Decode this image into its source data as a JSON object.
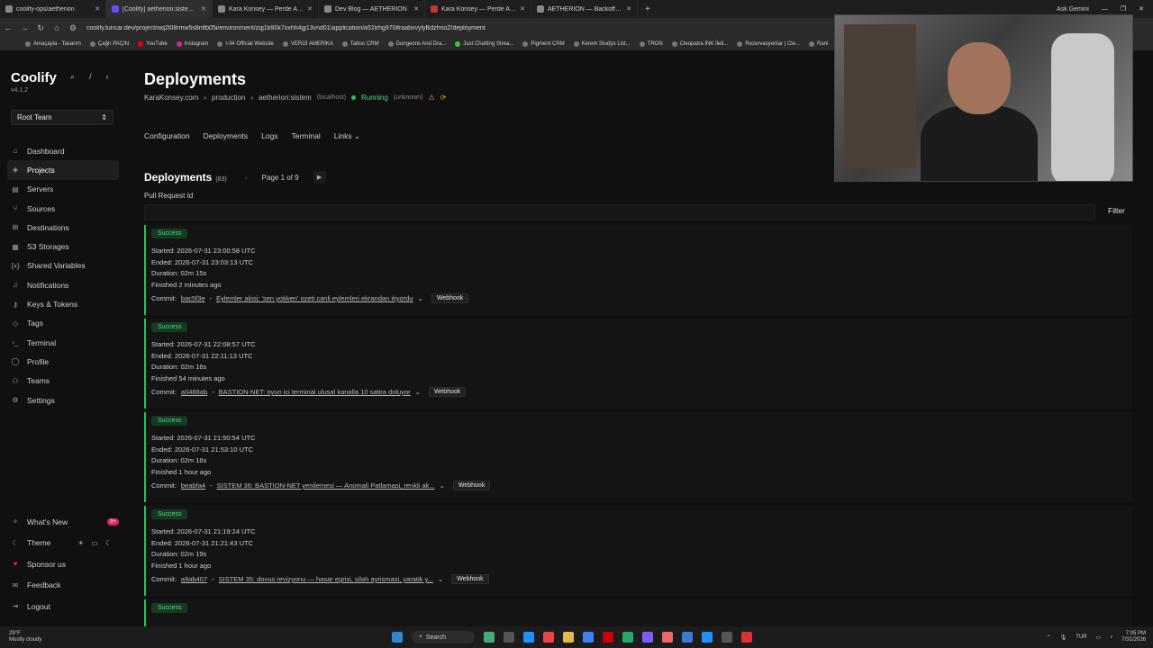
{
  "browser": {
    "tabs": [
      {
        "title": "coolify-ops/aetherion",
        "active": false
      },
      {
        "title": "[Coolify] aetherion:sistem - Deploy",
        "active": true
      },
      {
        "title": "Kara Konsey — Perde Arakası",
        "active": false
      },
      {
        "title": "Dev Blog — AETHERION",
        "active": false
      },
      {
        "title": "Kara Konsey — Perde Arakası",
        "active": false
      },
      {
        "title": "AETHERION — Backoffice",
        "active": false
      }
    ],
    "new_tab": "+",
    "profile": "Ask Gemini",
    "url": "coolify.luncar.dev/project/wq2l08rmw5s8nlfb05i/environment/zqj1b90k7xxhh4gj13vnd01/application/a51trhg970ifraabvvylyBdzhnoZ/deployment",
    "bookmarks": [
      "Amaçayla - Tasarım",
      "Çağrı PAÇIN",
      "YouTube",
      "Instagram",
      "I-94 Official Website",
      "VERGİ AMERİKA",
      "Tattoo CRM",
      "Dungeons And Dra...",
      "Just Chatting Strea...",
      "Pigment CRM",
      "Kerem Studyo List...",
      "TRON",
      "Cleopatra INK İleti...",
      "Rezervasyonlar | Cle...",
      "Rani"
    ]
  },
  "sidebar": {
    "brand": "Coolify",
    "version": "v4.1.2",
    "shortcut": "/",
    "team": "Root Team",
    "items": [
      {
        "label": "Dashboard",
        "icon": "home-icon",
        "active": false
      },
      {
        "label": "Projects",
        "icon": "layers-icon",
        "active": true
      },
      {
        "label": "Servers",
        "icon": "server-icon",
        "active": false
      },
      {
        "label": "Sources",
        "icon": "git-icon",
        "active": false
      },
      {
        "label": "Destinations",
        "icon": "destination-icon",
        "active": false
      },
      {
        "label": "S3 Storages",
        "icon": "storage-icon",
        "active": false
      },
      {
        "label": "Shared Variables",
        "icon": "variable-icon",
        "active": false
      },
      {
        "label": "Notifications",
        "icon": "bell-icon",
        "active": false
      },
      {
        "label": "Keys & Tokens",
        "icon": "key-icon",
        "active": false
      },
      {
        "label": "Tags",
        "icon": "tag-icon",
        "active": false
      },
      {
        "label": "Terminal",
        "icon": "terminal-icon",
        "active": false
      },
      {
        "label": "Profile",
        "icon": "user-icon",
        "active": false
      },
      {
        "label": "Teams",
        "icon": "users-icon",
        "active": false
      },
      {
        "label": "Settings",
        "icon": "gear-icon",
        "active": false
      }
    ],
    "bottom": [
      {
        "label": "What's New",
        "badge": "9+"
      },
      {
        "label": "Theme"
      },
      {
        "label": "Sponsor us"
      },
      {
        "label": "Feedback"
      },
      {
        "label": "Logout"
      }
    ]
  },
  "main": {
    "title": "Deployments",
    "breadcrumb": {
      "project": "KaraKonsey.com",
      "environment": "production",
      "application": "aetherion:sistem",
      "host": "(localhost)",
      "status": "Running",
      "status_detail": "(unknown)"
    },
    "tabs": [
      "Configuration",
      "Deployments",
      "Logs",
      "Terminal",
      "Links"
    ],
    "section_title": "Deployments",
    "count": "(83)",
    "page": "Page 1 of 9",
    "pr_label": "Pull Request Id",
    "filter_label": "Filter",
    "colors": {
      "success": "#22c55e",
      "warning": "#f59e0b"
    }
  },
  "deployments": [
    {
      "status": "Success",
      "started": "Started: 2026-07-31 23:00:58 UTC",
      "ended": "Ended: 2026-07-31 23:03:13 UTC",
      "duration": "Duration: 02m 15s",
      "finished": "Finished 2 minutes ago",
      "commit_label": "Commit:",
      "sha": "bac5f3e",
      "message": "Eylemler akisi: 'sen yokken' ozeti canli eylemleri ekrandan itiyordu",
      "trigger": "Webhook"
    },
    {
      "status": "Success",
      "started": "Started: 2026-07-31 22:08:57 UTC",
      "ended": "Ended: 2026-07-31 22:11:13 UTC",
      "duration": "Duration: 02m 16s",
      "finished": "Finished 54 minutes ago",
      "commit_label": "Commit:",
      "sha": "a0488ab",
      "message": "BASTION-NET: oyun ici terminal ulusal kanalla 10 satira doluyor",
      "trigger": "Webhook"
    },
    {
      "status": "Success",
      "started": "Started: 2026-07-31 21:50:54 UTC",
      "ended": "Ended: 2026-07-31 21:53:10 UTC",
      "duration": "Duration: 02m 16s",
      "finished": "Finished 1 hour ago",
      "commit_label": "Commit:",
      "sha": "beabfa4",
      "message": "SISTEM 36: BASTION-NET yenilemesi — Anomali Patlamasi, renkli ak...",
      "trigger": "Webhook"
    },
    {
      "status": "Success",
      "started": "Started: 2026-07-31 21:19:24 UTC",
      "ended": "Ended: 2026-07-31 21:21:43 UTC",
      "duration": "Duration: 02m 19s",
      "finished": "Finished 1 hour ago",
      "commit_label": "Commit:",
      "sha": "a9ab407",
      "message": "SISTEM 35: dovus revizyonu — hasar egrisi, silah ayrismasi, yaratik y...",
      "trigger": "Webhook"
    },
    {
      "status": "Success",
      "started": "",
      "ended": "",
      "duration": "",
      "finished": "",
      "commit_label": "",
      "sha": "",
      "message": "",
      "trigger": ""
    }
  ],
  "taskbar": {
    "weather_temp": "29°F",
    "weather_desc": "Mostly cloudy",
    "search": "Search",
    "lang": "TUR",
    "time": "7:05 PM",
    "date": "7/31/2026"
  }
}
